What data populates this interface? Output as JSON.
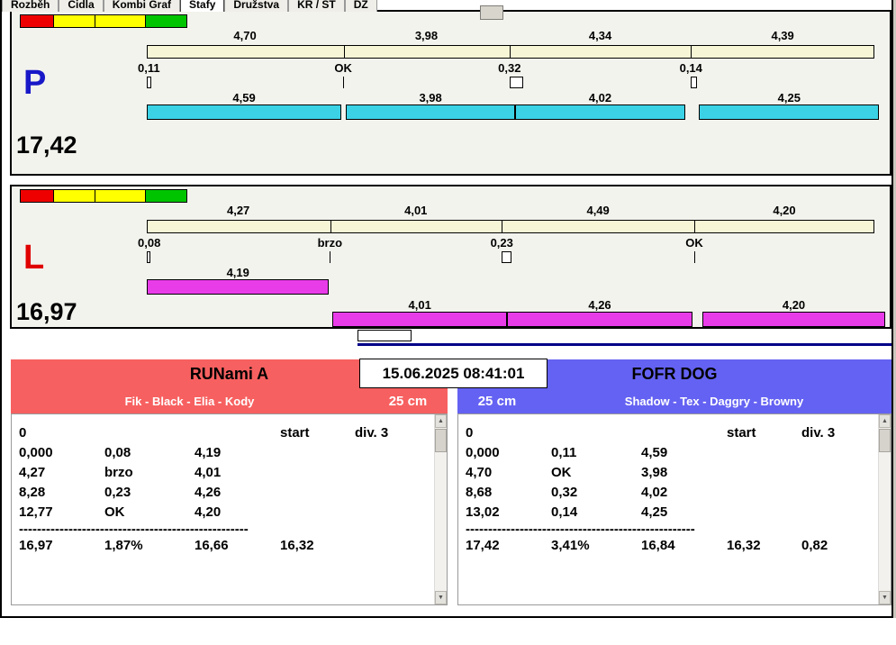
{
  "tabbar": {
    "tabs": [
      {
        "label": "Rozběh",
        "active": false
      },
      {
        "label": "Čidla",
        "active": false
      },
      {
        "label": "Kombi Graf",
        "active": false
      },
      {
        "label": "Štafy",
        "active": true
      },
      {
        "label": "Družstva",
        "active": false
      },
      {
        "label": "KR / ST",
        "active": false
      },
      {
        "label": "DZ",
        "active": false
      }
    ]
  },
  "colors": {
    "split_bar_bg": "#f6f6d6",
    "progress_line": "#000088"
  },
  "panels": [
    {
      "letter": "P",
      "letter_color": "#1818c8",
      "total": "17,42",
      "lights": [
        "#ee0000",
        "#ffff00",
        "#ffff00",
        "#00c400"
      ],
      "splits": [
        "4,70",
        "3,98",
        "4,34",
        "4,39"
      ],
      "marks": [
        "0,11",
        "OK",
        "0,32",
        "0,14"
      ],
      "runs": [
        {
          "value": "4,59",
          "row": 0
        },
        {
          "value": "3,98",
          "row": 0
        },
        {
          "value": "4,02",
          "row": 0
        },
        {
          "value": "4,25",
          "row": 0
        }
      ],
      "bar_color": "#3bd2e6"
    },
    {
      "letter": "L",
      "letter_color": "#e00000",
      "total": "16,97",
      "lights": [
        "#ee0000",
        "#ffff00",
        "#ffff00",
        "#00c400"
      ],
      "splits": [
        "4,27",
        "4,01",
        "4,49",
        "4,20"
      ],
      "marks": [
        "0,08",
        "brzo",
        "0,23",
        "OK"
      ],
      "runs": [
        {
          "value": "4,19",
          "row": 0
        },
        {
          "value": "4,01",
          "row": 1
        },
        {
          "value": "4,26",
          "row": 1
        },
        {
          "value": "4,20",
          "row": 1
        }
      ],
      "bar_color": "#e93ce9"
    }
  ],
  "divider": {
    "datetime": "15.06.2025 08:41:01"
  },
  "teams": [
    {
      "name": "RUNami A",
      "dogs": "Fik - Black - Elia - Kody",
      "height_label": "25 cm",
      "accent": "#f76060",
      "table": {
        "zero": "0",
        "start_label": "start",
        "div_label": "div. 3",
        "rows": [
          [
            "0,000",
            "0,08",
            "4,19"
          ],
          [
            "4,27",
            "brzo",
            "4,01"
          ],
          [
            "8,28",
            "0,23",
            "4,26"
          ],
          [
            "12,77",
            "OK",
            "4,20"
          ]
        ],
        "separator": "---------------------------------------------------",
        "totals": [
          "16,97",
          "1,87%",
          "16,66",
          "16,32"
        ]
      }
    },
    {
      "name": "FOFR DOG",
      "dogs": "Shadow - Tex - Daggry - Browny",
      "height_label": "25 cm",
      "accent": "#6462f2",
      "table": {
        "zero": "0",
        "start_label": "start",
        "div_label": "div. 3",
        "rows": [
          [
            "0,000",
            "0,11",
            "4,59"
          ],
          [
            "4,70",
            "OK",
            "3,98"
          ],
          [
            "8,68",
            "0,32",
            "4,02"
          ],
          [
            "13,02",
            "0,14",
            "4,25"
          ]
        ],
        "separator": "---------------------------------------------------",
        "totals": [
          "17,42",
          "3,41%",
          "16,84",
          "16,32",
          "0,82"
        ]
      }
    }
  ]
}
